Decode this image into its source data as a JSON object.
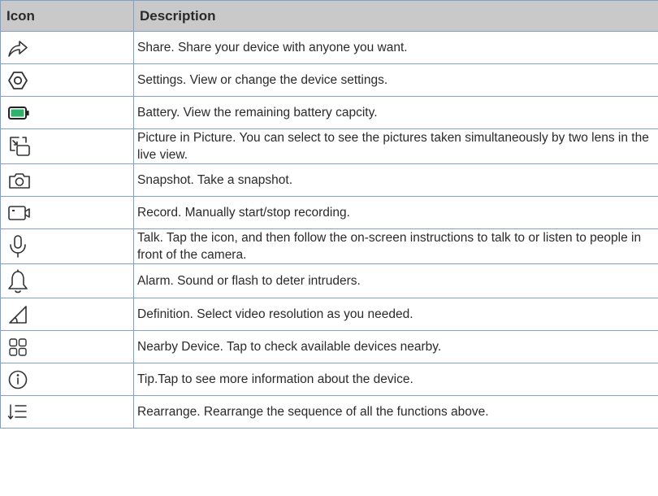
{
  "header": {
    "icon_col": "Icon",
    "description_col": "Description"
  },
  "rows": [
    {
      "icon": "share-icon",
      "description": "Share. Share your device with anyone you want."
    },
    {
      "icon": "settings-icon",
      "description": "Settings. View or change the device settings."
    },
    {
      "icon": "battery-icon",
      "description": "Battery. View the remaining battery capcity."
    },
    {
      "icon": "picture-in-picture-icon",
      "description": "Picture in Picture. You can select to see the pictures taken simultaneously by two lens in the live view."
    },
    {
      "icon": "snapshot-icon",
      "description": "Snapshot. Take a snapshot."
    },
    {
      "icon": "record-icon",
      "description": "Record. Manually start/stop recording."
    },
    {
      "icon": "microphone-icon",
      "description": "Talk. Tap the icon, and then follow the on-screen instructions to talk to or listen to people in front of the camera."
    },
    {
      "icon": "bell-icon",
      "description": "Alarm. Sound or flash to deter intruders."
    },
    {
      "icon": "definition-icon",
      "description": "Definition. Select video resolution as you needed."
    },
    {
      "icon": "grid-icon",
      "description": "Nearby Device. Tap to check available devices nearby."
    },
    {
      "icon": "info-icon",
      "description": "Tip.Tap to see more information about the device."
    },
    {
      "icon": "rearrange-icon",
      "description": "Rearrange. Rearrange the sequence of all the functions above."
    }
  ],
  "colors": {
    "header_bg": "#c9c9c9",
    "border": "#7fa0c9",
    "battery_fill": "#2fb36a"
  }
}
